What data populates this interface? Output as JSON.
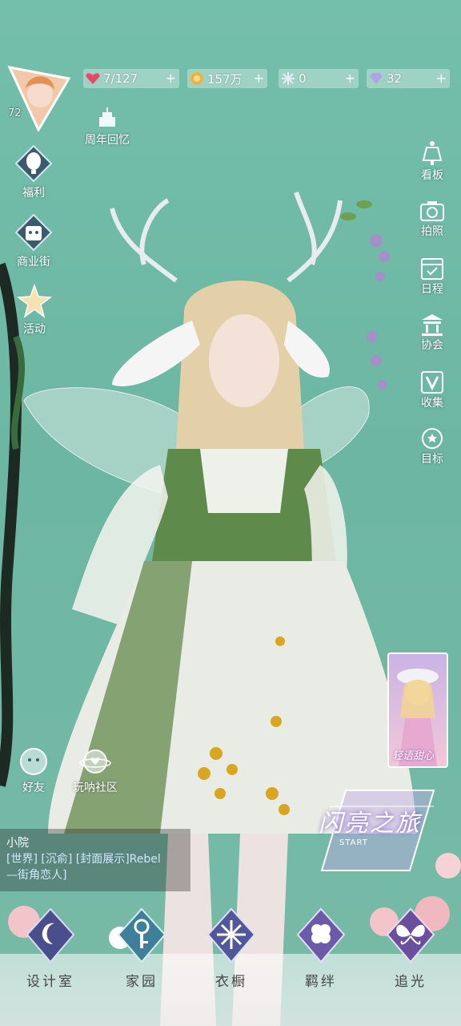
{
  "player": {
    "level": "72"
  },
  "currencies": [
    {
      "icon": "heart-gem-icon",
      "value": "7/127",
      "color": "#e8476a"
    },
    {
      "icon": "gold-coin-icon",
      "value": "157万",
      "color": "#e8b447"
    },
    {
      "icon": "snowflake-crystal-icon",
      "value": "0",
      "color": "#c9d6ef"
    },
    {
      "icon": "diamond-icon",
      "value": "32",
      "color": "#b0a2e8"
    }
  ],
  "plus_label": "+",
  "anniversary": {
    "label": "周年回忆"
  },
  "left_menu": [
    {
      "id": "welfare",
      "label": "福利",
      "icon": "balloon-icon"
    },
    {
      "id": "shopping-street",
      "label": "商业街",
      "icon": "shopping-bag-icon"
    },
    {
      "id": "events",
      "label": "活动",
      "icon": "star-icon"
    }
  ],
  "right_menu": [
    {
      "id": "board",
      "label": "看板",
      "icon": "dress-form-icon"
    },
    {
      "id": "photo",
      "label": "拍照",
      "icon": "camera-icon"
    },
    {
      "id": "schedule",
      "label": "日程",
      "icon": "calendar-icon"
    },
    {
      "id": "association",
      "label": "协会",
      "icon": "building-icon"
    },
    {
      "id": "collection",
      "label": "收集",
      "icon": "v-badge-icon"
    },
    {
      "id": "goal",
      "label": "目标",
      "icon": "target-badge-icon"
    }
  ],
  "social": [
    {
      "id": "friends",
      "label": "好友",
      "icon": "friends-icon"
    },
    {
      "id": "community",
      "label": "玩呐社区",
      "icon": "planet-heart-icon"
    }
  ],
  "promo_card": {
    "text": "轻语甜心"
  },
  "start_banner": {
    "title": "闪亮之旅",
    "sub": "START"
  },
  "chat": {
    "name": "小院",
    "line1": "[世界] [沉俞] [封面展示]Rebel",
    "line2": "—街角恋人]"
  },
  "bottom_nav": [
    {
      "id": "design-room",
      "label": "设计室",
      "icon": "moon-hanger-icon"
    },
    {
      "id": "home",
      "label": "家园",
      "icon": "key-icon"
    },
    {
      "id": "wardrobe",
      "label": "衣橱",
      "icon": "snowflake-icon"
    },
    {
      "id": "bond",
      "label": "羁绊",
      "icon": "clover-icon"
    },
    {
      "id": "chase-light",
      "label": "追光",
      "icon": "butterfly-icon"
    }
  ]
}
